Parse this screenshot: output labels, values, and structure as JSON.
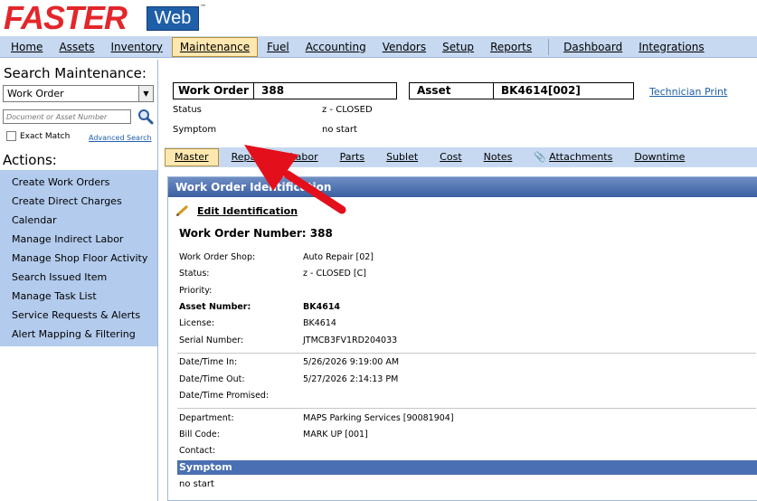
{
  "logo": {
    "faster": "FASTER",
    "web": "Web",
    "tm": "™"
  },
  "menu": [
    "Home",
    "Assets",
    "Inventory",
    "Maintenance",
    "Fuel",
    "Accounting",
    "Vendors",
    "Setup",
    "Reports",
    "Dashboard",
    "Integrations"
  ],
  "menu_active": "Maintenance",
  "sidebar": {
    "search_title": "Search Maintenance:",
    "search_type": "Work Order",
    "search_placeholder": "Document or Asset Number",
    "exact_match": "Exact Match",
    "advanced_search": "Advanced Search",
    "actions_title": "Actions:",
    "actions": [
      "Create Work Orders",
      "Create Direct Charges",
      "Calendar",
      "Manage Indirect Labor",
      "Manage Shop Floor Activity",
      "Search Issued Item",
      "Manage Task List",
      "Service Requests & Alerts",
      "Alert Mapping & Filtering"
    ]
  },
  "header": {
    "wo_label": "Work Order",
    "wo_value": "388",
    "asset_label": "Asset",
    "asset_value": "BK4614[002]",
    "tech_print": "Technician Print",
    "status_label": "Status",
    "status_value": "z - CLOSED",
    "symptom_label": "Symptom",
    "symptom_value": "no start"
  },
  "tabs": [
    "Master",
    "Repairs",
    "Labor",
    "Parts",
    "Sublet",
    "Cost",
    "Notes",
    "Attachments",
    "Downtime"
  ],
  "tab_active": "Master",
  "panel": {
    "title": "Work Order Identification",
    "edit_label": "Edit Identification",
    "wo_number": "Work Order Number: 388",
    "group1": [
      {
        "label": "Work Order Shop:",
        "value": "Auto Repair [02]"
      },
      {
        "label": "Status:",
        "value": "z - CLOSED [C]"
      },
      {
        "label": "Priority:",
        "value": ""
      },
      {
        "label": "Asset Number:",
        "value": "BK4614"
      },
      {
        "label": "License:",
        "value": "BK4614"
      },
      {
        "label": "Serial Number:",
        "value": "JTMCB3FV1RD204033"
      }
    ],
    "group2": [
      {
        "label": "Date/Time In:",
        "value": "5/26/2026 9:19:00 AM"
      },
      {
        "label": "Date/Time Out:",
        "value": "5/27/2026 2:14:13 PM"
      },
      {
        "label": "Date/Time Promised:",
        "value": ""
      }
    ],
    "group3": [
      {
        "label": "Department:",
        "value": "MAPS Parking Services [90081904]"
      },
      {
        "label": "Bill Code:",
        "value": "MARK UP [001]"
      },
      {
        "label": "Contact:",
        "value": ""
      }
    ],
    "symptom_title": "Symptom",
    "symptom_text": "no start"
  }
}
